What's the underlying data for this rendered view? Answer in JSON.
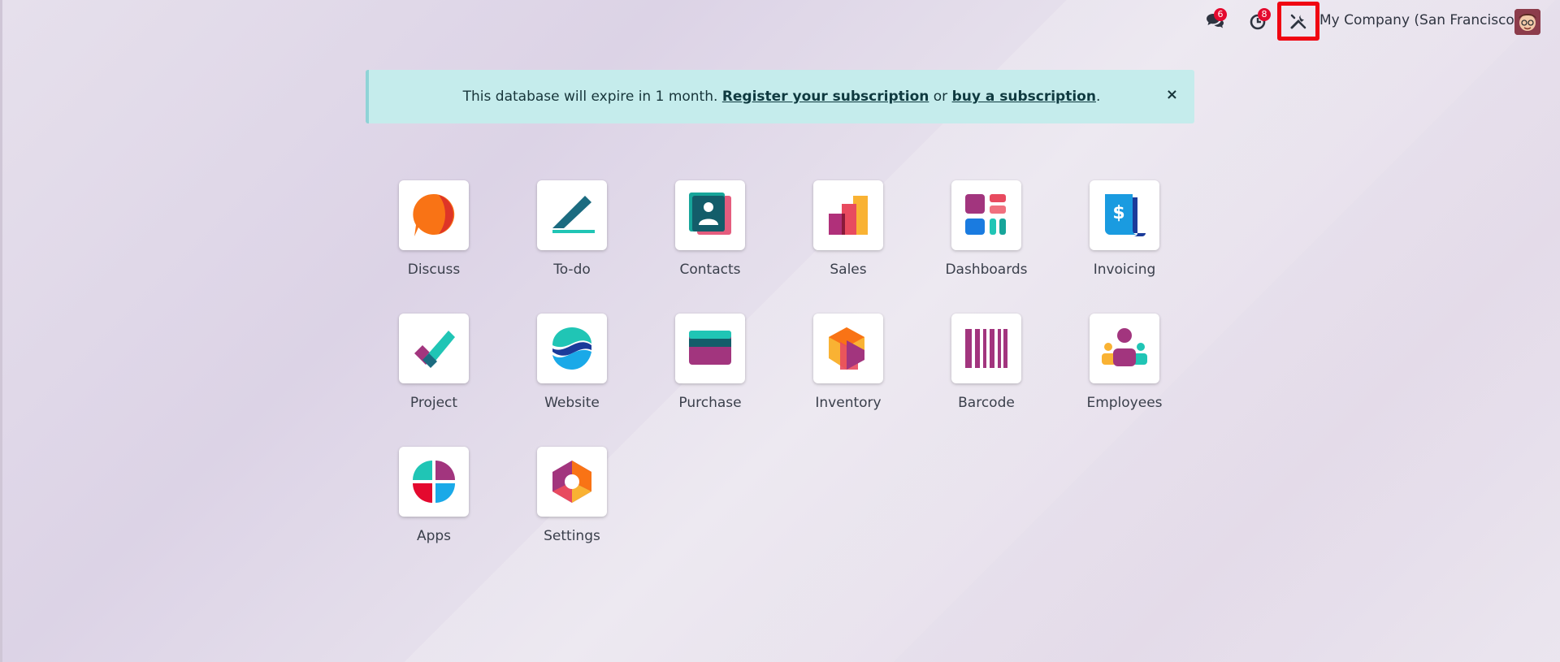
{
  "topbar": {
    "messages_badge": "6",
    "activities_badge": "8",
    "company": "My Company (San Francisco)"
  },
  "banner": {
    "text_before": "This database will expire in 1 month.",
    "register_link": "Register your subscription",
    "text_middle": "or",
    "buy_link": "buy a subscription",
    "text_after": ".",
    "close": "×"
  },
  "apps": [
    {
      "label": "Discuss",
      "icon": "discuss-icon"
    },
    {
      "label": "To-do",
      "icon": "todo-icon"
    },
    {
      "label": "Contacts",
      "icon": "contacts-icon"
    },
    {
      "label": "Sales",
      "icon": "sales-icon"
    },
    {
      "label": "Dashboards",
      "icon": "dashboards-icon"
    },
    {
      "label": "Invoicing",
      "icon": "invoicing-icon"
    },
    {
      "label": "Project",
      "icon": "project-icon"
    },
    {
      "label": "Website",
      "icon": "website-icon"
    },
    {
      "label": "Purchase",
      "icon": "purchase-icon"
    },
    {
      "label": "Inventory",
      "icon": "inventory-icon"
    },
    {
      "label": "Barcode",
      "icon": "barcode-icon"
    },
    {
      "label": "Employees",
      "icon": "employees-icon"
    },
    {
      "label": "Apps",
      "icon": "apps-icon"
    },
    {
      "label": "Settings",
      "icon": "settings-icon"
    }
  ],
  "colors": {
    "badge": "#e4092e",
    "highlight": "#f00511",
    "banner_bg": "#c5ecec"
  }
}
